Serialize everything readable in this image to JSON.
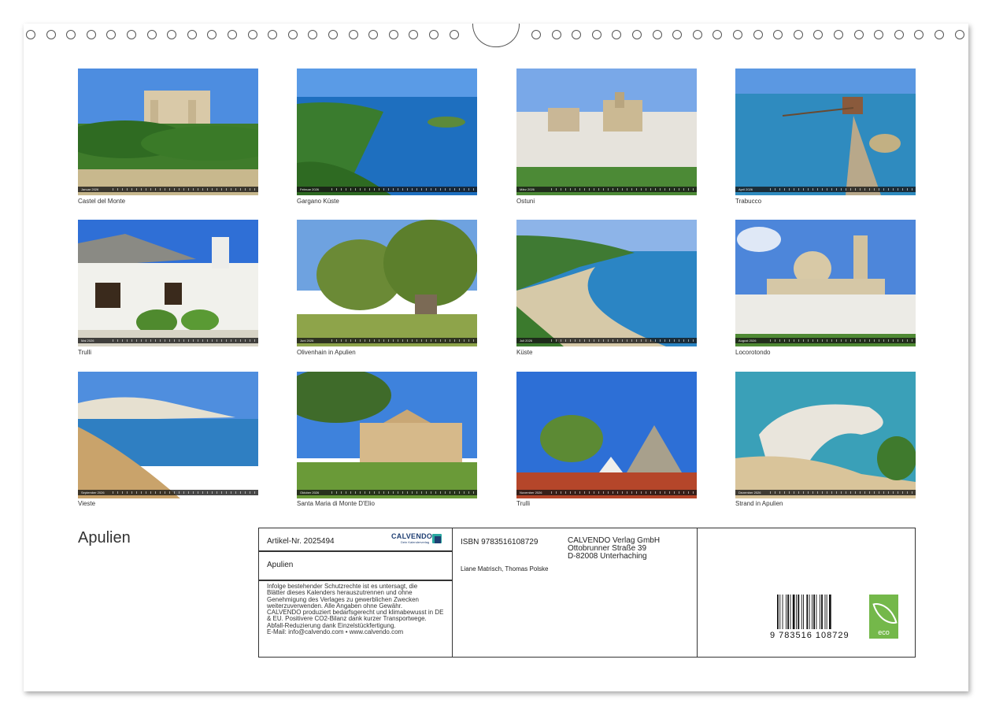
{
  "calendar": {
    "title": "Apulien",
    "photos": [
      {
        "caption": "Castel del Monte",
        "month": "Januar 2026"
      },
      {
        "caption": "Gargano Küste",
        "month": "Februar 2026"
      },
      {
        "caption": "Ostuni",
        "month": "März 2026"
      },
      {
        "caption": "Trabucco",
        "month": "April 2026"
      },
      {
        "caption": "Trulli",
        "month": "Mai 2026"
      },
      {
        "caption": "Olivenhain in Apulien",
        "month": "Juni 2026"
      },
      {
        "caption": "Küste",
        "month": "Juli 2026"
      },
      {
        "caption": "Locorotondo",
        "month": "August 2026"
      },
      {
        "caption": "Vieste",
        "month": "September 2026"
      },
      {
        "caption": "Santa Maria di Monte D'Elio",
        "month": "Oktober 2026"
      },
      {
        "caption": "Trulli",
        "month": "November 2026"
      },
      {
        "caption": "Strand in Apulien",
        "month": "Dezember 2026"
      }
    ]
  },
  "info": {
    "article": "Artikel-Nr. 2025494",
    "name": "Apulien",
    "legal": [
      "Infolge bestehender Schutzrechte ist es untersagt, die",
      "Blätter dieses Kalenders herauszutrennen und ohne",
      "Genehmigung des Verlages zu gewerblichen Zwecken",
      "weiterzuverwenden. Alle Angaben ohne Gewähr.",
      "CALVENDO produziert bedarfsgerecht und klimabewusst in DE",
      "& EU. Positivere CO2-Bilanz dank kurzer Transportwege.",
      "Abfall-Reduzierung dank Einzelstückfertigung.",
      "E-Mail: info@calvendo.com • www.calvendo.com"
    ],
    "isbn": "ISBN 9783516108729",
    "authors": "Liane Matrisch, Thomas Polske",
    "publisher": [
      "CALVENDO Verlag GmbH",
      "Ottobrunner Straße 39",
      "D-82008 Unterhaching"
    ],
    "barcode_number": "9 783516 108729",
    "logo_word": "CALVENDO",
    "logo_sub": "Dein Kalenderverlag",
    "eco_label": "eco"
  },
  "colors": {
    "sky": "#3f7fd8",
    "sea": "#1d6fb3",
    "green": "#3c7d2a",
    "eco_green": "#74b84a",
    "calvendo_blue": "#1f3f73"
  }
}
